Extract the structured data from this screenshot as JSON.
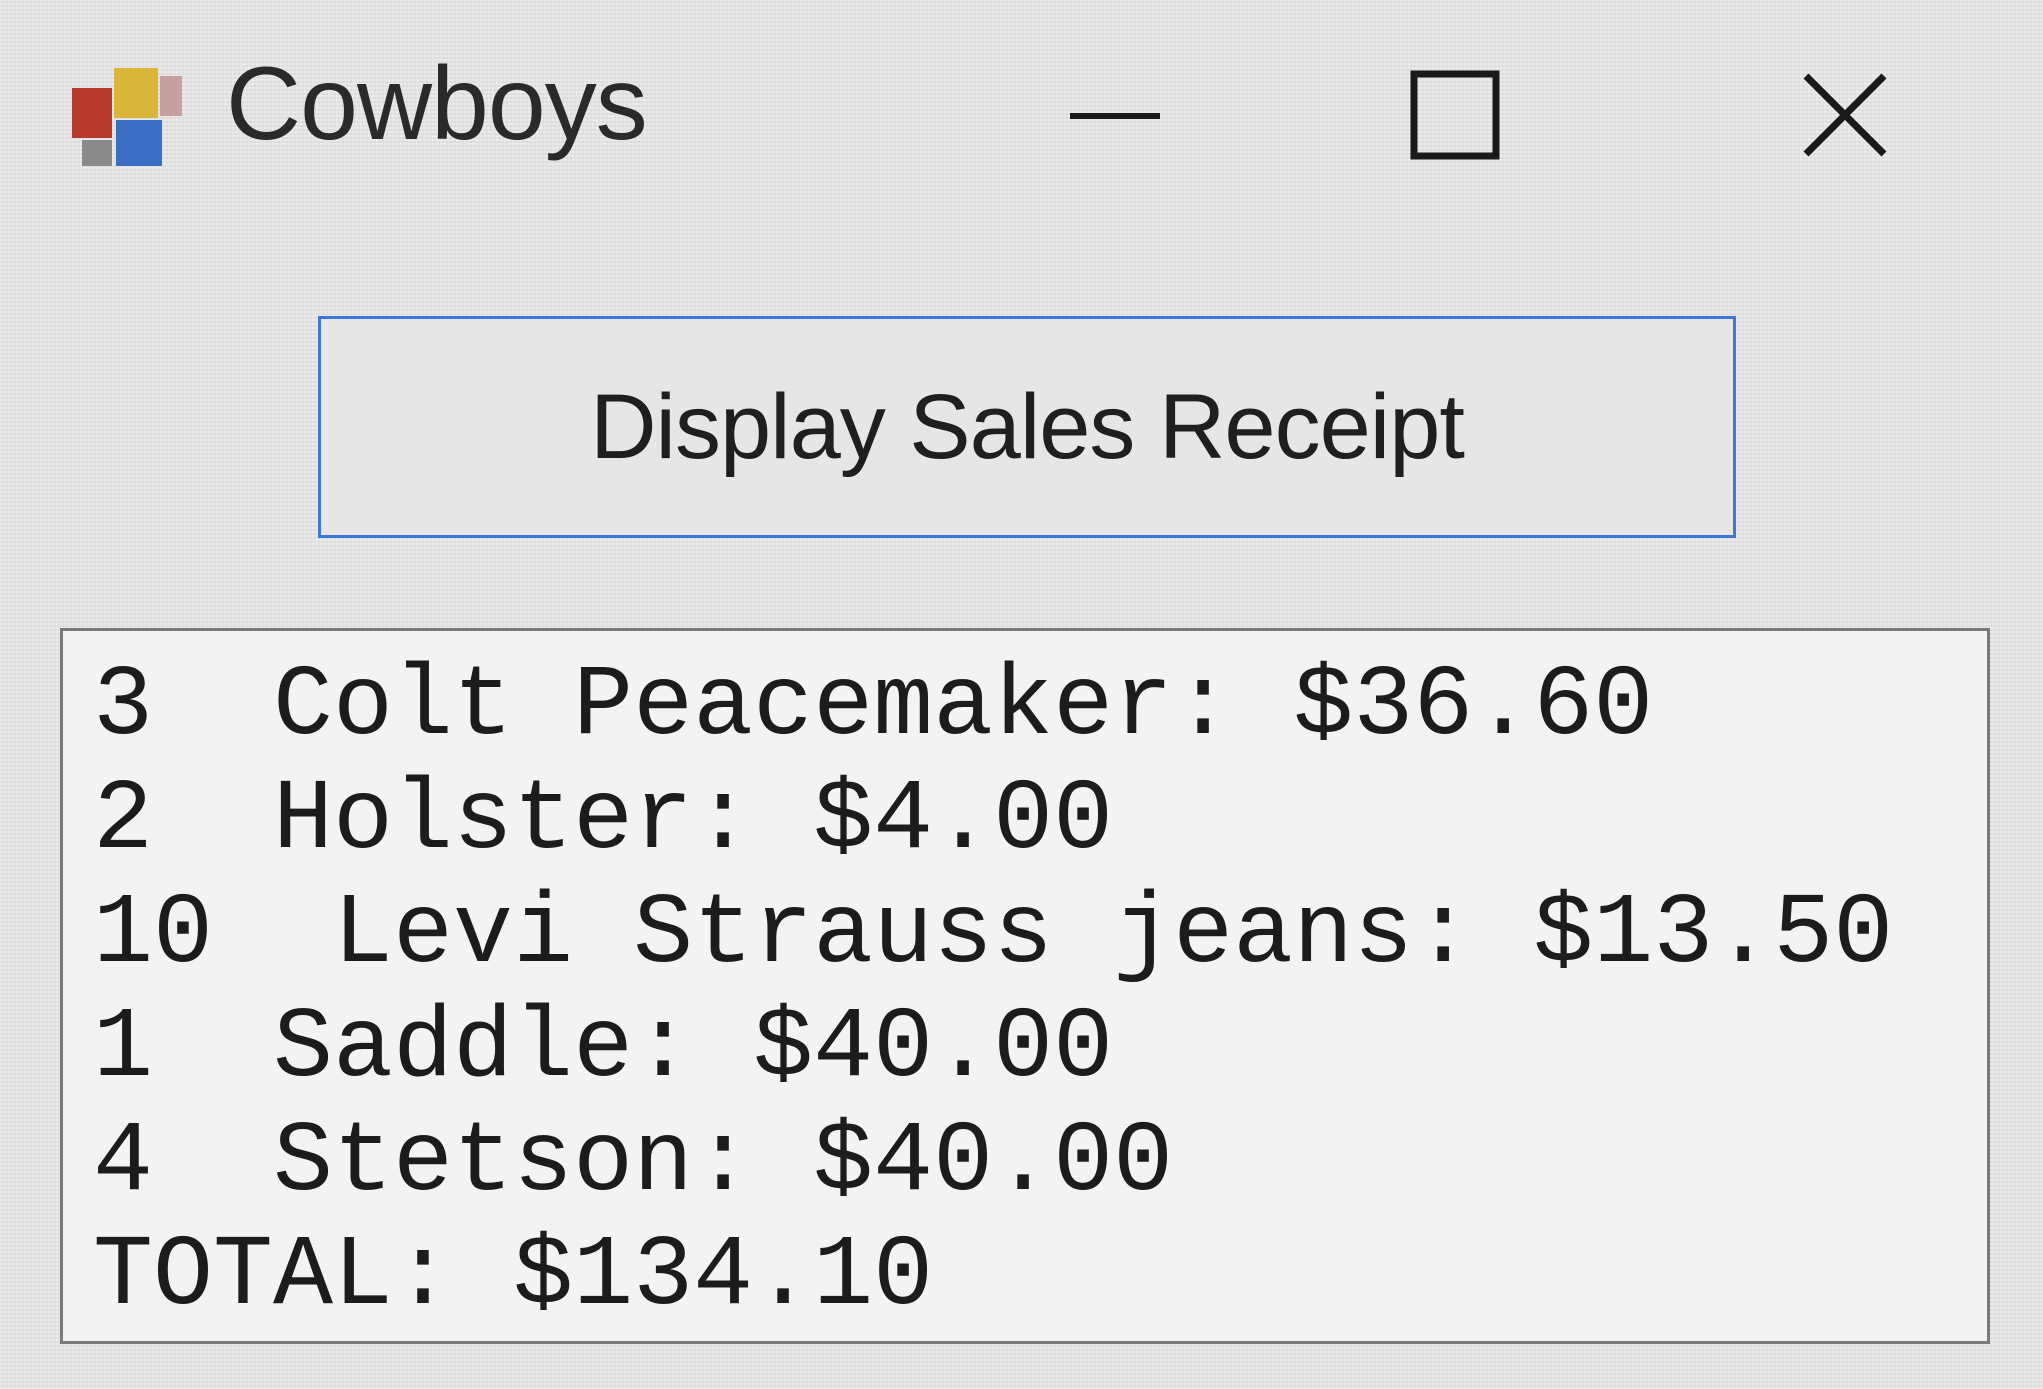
{
  "window": {
    "title": "Cowboys",
    "icon": "app-icon",
    "controls": {
      "minimize_icon": "minimize-icon",
      "maximize_icon": "maximize-icon",
      "close_icon": "close-icon"
    }
  },
  "button": {
    "label": "Display Sales Receipt"
  },
  "listbox": {
    "items": [
      "3  Colt Peacemaker: $36.60",
      "2  Holster: $4.00",
      "10  Levi Strauss jeans: $13.50",
      "1  Saddle: $40.00",
      "4  Stetson: $40.00",
      "TOTAL: $134.10"
    ]
  },
  "colors": {
    "button_border": "#3c78d8",
    "window_bg": "#e4e4e4",
    "listbox_border": "#7a7a7a"
  }
}
